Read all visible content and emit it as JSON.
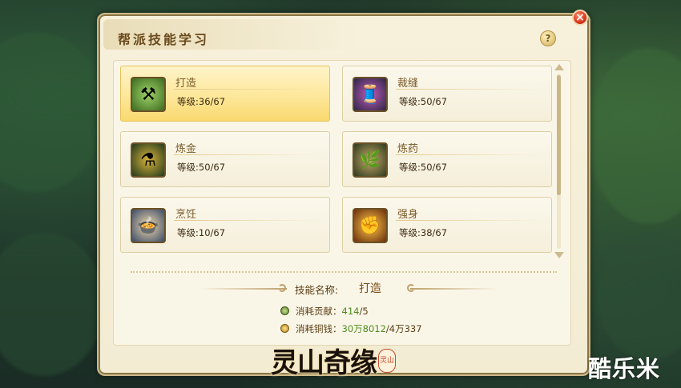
{
  "window": {
    "title": "帮派技能学习",
    "close_glyph": "×",
    "help_glyph": "?"
  },
  "skills": [
    {
      "name": "打造",
      "level": "等级:36/67",
      "icon": "hammer-icon",
      "icon_glyph": "⚒",
      "selected": true
    },
    {
      "name": "裁缝",
      "level": "等级:50/67",
      "icon": "thread-icon",
      "icon_glyph": "🧵",
      "selected": false
    },
    {
      "name": "炼金",
      "level": "等级:50/67",
      "icon": "gourd-icon",
      "icon_glyph": "⚗",
      "selected": false
    },
    {
      "name": "炼药",
      "level": "等级:50/67",
      "icon": "herb-icon",
      "icon_glyph": "🌿",
      "selected": false
    },
    {
      "name": "烹饪",
      "level": "等级:10/67",
      "icon": "dumpling-icon",
      "icon_glyph": "🍲",
      "selected": false
    },
    {
      "name": "强身",
      "level": "等级:38/67",
      "icon": "fist-icon",
      "icon_glyph": "✊",
      "selected": false
    }
  ],
  "detail": {
    "skill_name_label": "技能名称:",
    "skill_name_value": "打造",
    "contribution_label": "消耗贡献：",
    "contribution_current": "414",
    "contribution_required": "/5",
    "money_label": "消耗铜钱：",
    "money_current": "30万8012",
    "money_required": "/4万337"
  },
  "logo": {
    "text": "灵山奇缘",
    "seal": "灵山"
  },
  "watermark": "酷乐米",
  "colors": {
    "accent_gold": "#f9d96f",
    "title_brown": "#6a4a1c",
    "value_green": "#4f8a1f",
    "close_red": "#d9361c"
  }
}
